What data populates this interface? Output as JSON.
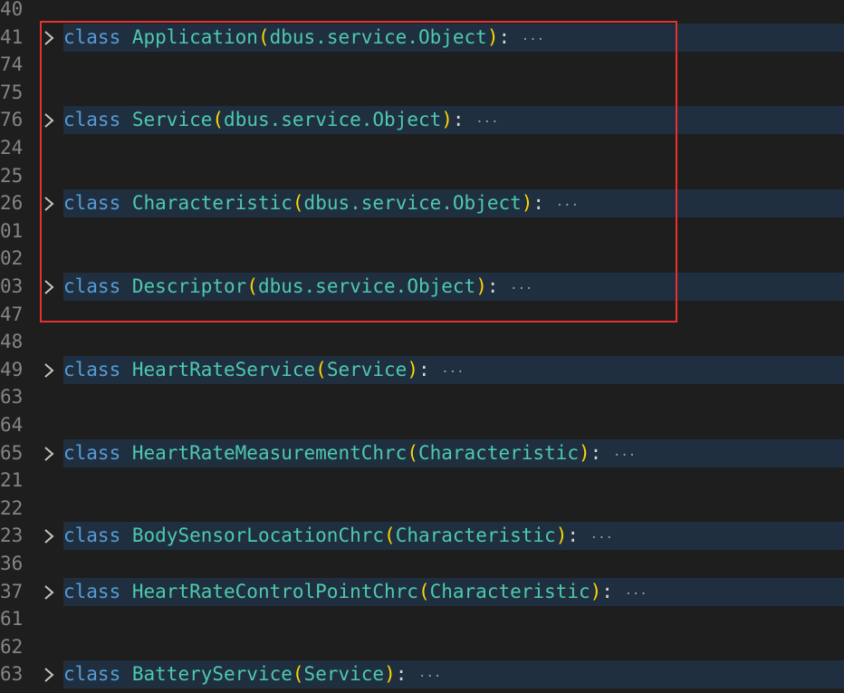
{
  "lines": [
    {
      "num": "40"
    },
    {
      "num": "41",
      "folded": true,
      "kw": "class",
      "name": "Application",
      "base": "dbus.service.Object",
      "ellipsis": "···"
    },
    {
      "num": "74"
    },
    {
      "num": "75"
    },
    {
      "num": "76",
      "folded": true,
      "kw": "class",
      "name": "Service",
      "base": "dbus.service.Object",
      "ellipsis": "···"
    },
    {
      "num": "24"
    },
    {
      "num": "25"
    },
    {
      "num": "26",
      "folded": true,
      "kw": "class",
      "name": "Characteristic",
      "base": "dbus.service.Object",
      "ellipsis": "···"
    },
    {
      "num": "01"
    },
    {
      "num": "02"
    },
    {
      "num": "03",
      "folded": true,
      "kw": "class",
      "name": "Descriptor",
      "base": "dbus.service.Object",
      "ellipsis": "···"
    },
    {
      "num": "47"
    },
    {
      "num": "48"
    },
    {
      "num": "49",
      "folded": true,
      "kw": "class",
      "name": "HeartRateService",
      "base": "Service",
      "ellipsis": "···"
    },
    {
      "num": "63"
    },
    {
      "num": "64"
    },
    {
      "num": "65",
      "folded": true,
      "kw": "class",
      "name": "HeartRateMeasurementChrc",
      "base": "Characteristic",
      "ellipsis": "···"
    },
    {
      "num": "21"
    },
    {
      "num": "22"
    },
    {
      "num": "23",
      "folded": true,
      "kw": "class",
      "name": "BodySensorLocationChrc",
      "base": "Characteristic",
      "ellipsis": "···"
    },
    {
      "num": "36"
    },
    {
      "num": "37",
      "folded": true,
      "kw": "class",
      "name": "HeartRateControlPointChrc",
      "base": "Characteristic",
      "ellipsis": "···"
    },
    {
      "num": "61"
    },
    {
      "num": "62"
    },
    {
      "num": "63",
      "folded": true,
      "kw": "class",
      "name": "BatteryService",
      "base": "Service",
      "ellipsis": "···"
    }
  ]
}
